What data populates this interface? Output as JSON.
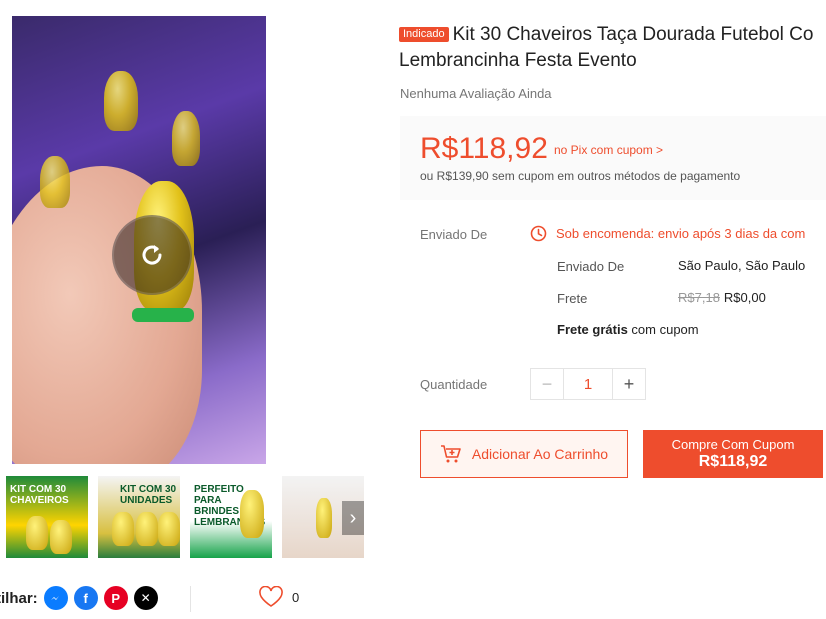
{
  "product": {
    "badge": "Indicado",
    "title_line1": "Kit 30 Chaveiros Taça Dourada Futebol Co",
    "title_line2": "Lembrancinha Festa Evento",
    "rating_text": "Nenhuma Avaliação Ainda"
  },
  "price": {
    "main": "R$118,92",
    "pix_note": "no Pix com cupom >",
    "alt_text": "ou R$139,90 sem cupom em outros métodos de pagamento"
  },
  "shipping": {
    "label": "Enviado De",
    "status": "Sob encomenda: envio após 3 dias da com",
    "from_label": "Enviado De",
    "from_value": "São Paulo, São Paulo",
    "freight_label": "Frete",
    "freight_old": "R$7,18",
    "freight_new": "R$0,00",
    "free_bold": "Frete grátis",
    "free_rest": " com cupom"
  },
  "quantity": {
    "label": "Quantidade",
    "minus": "−",
    "value": "1",
    "plus": "+"
  },
  "actions": {
    "add_to_cart": "Adicionar Ao Carrinho",
    "buy_line1": "Compre Com Cupom",
    "buy_line2": "R$118,92"
  },
  "thumbnails": {
    "t1_text": "KIT COM 30 CHAVEIROS",
    "t2_text": "KIT COM 30 UNIDADES",
    "t3_text": "PERFEITO PARA BRINDES E LEMBRANÇAS",
    "next_glyph": "›"
  },
  "share": {
    "label": "tilhar:",
    "icons": [
      "messenger-icon",
      "facebook-icon",
      "pinterest-icon",
      "x-icon"
    ]
  },
  "likes": {
    "count": "0"
  },
  "colors": {
    "accent": "#ee4d2d",
    "messenger": "#0a7cff",
    "facebook": "#1877f2",
    "pinterest": "#e60023",
    "x": "#000000"
  }
}
